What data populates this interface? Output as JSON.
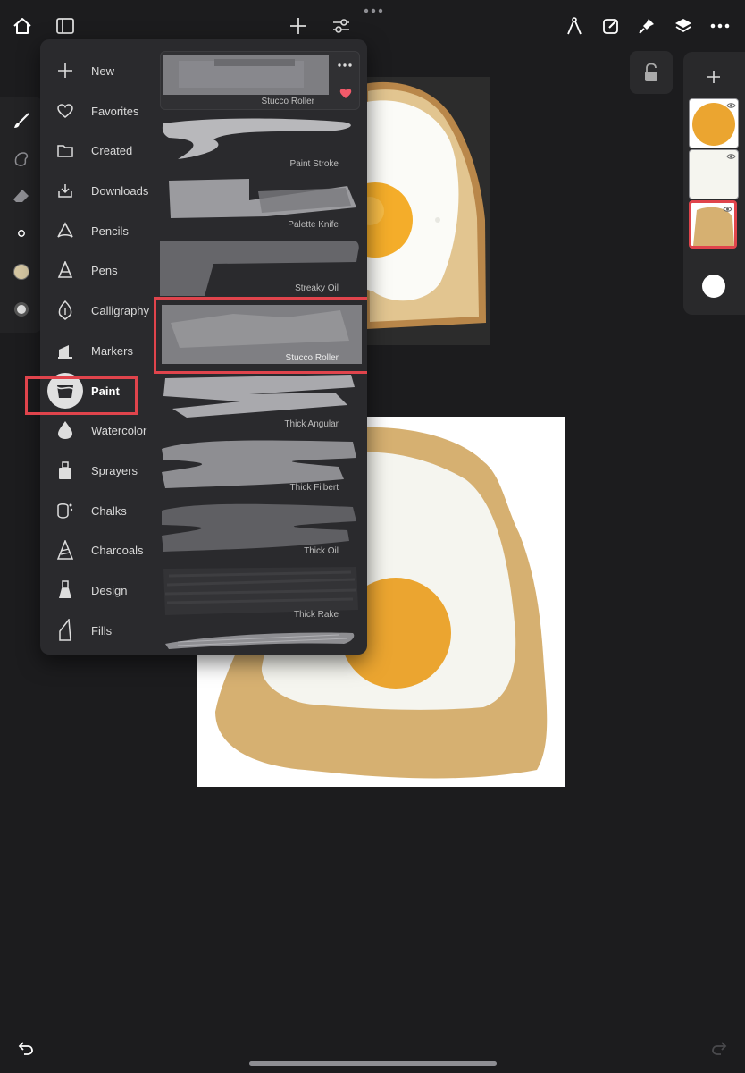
{
  "top_bar": {
    "left_icons": [
      "home-icon",
      "sidebar-toggle-icon"
    ],
    "center_icons": [
      "plus-icon",
      "sliders-icon"
    ],
    "right_icons": [
      "compass-icon",
      "edit-square-icon",
      "pin-icon",
      "layers-icon",
      "more-horizontal-icon"
    ]
  },
  "library": {
    "categories": [
      {
        "label": "New",
        "icon": "plus-icon"
      },
      {
        "label": "Favorites",
        "icon": "heart-icon"
      },
      {
        "label": "Created",
        "icon": "folder-icon"
      },
      {
        "label": "Downloads",
        "icon": "download-icon"
      },
      {
        "label": "Pencils",
        "icon": "pencil-icon"
      },
      {
        "label": "Pens",
        "icon": "pen-icon"
      },
      {
        "label": "Calligraphy",
        "icon": "calligraphy-nib-icon"
      },
      {
        "label": "Markers",
        "icon": "marker-icon"
      },
      {
        "label": "Paint",
        "icon": "paint-bucket-icon"
      },
      {
        "label": "Watercolor",
        "icon": "water-drop-icon"
      },
      {
        "label": "Sprayers",
        "icon": "spray-can-icon"
      },
      {
        "label": "Chalks",
        "icon": "chalk-icon"
      },
      {
        "label": "Charcoals",
        "icon": "charcoal-icon"
      },
      {
        "label": "Design",
        "icon": "design-icon"
      },
      {
        "label": "Fills",
        "icon": "fill-icon"
      }
    ],
    "selected_category": "Paint",
    "brushes": [
      {
        "label": "Stucco Roller",
        "favorite": true
      },
      {
        "label": "Paint Stroke"
      },
      {
        "label": "Palette Knife"
      },
      {
        "label": "Streaky Oil"
      },
      {
        "label": "Stucco Roller"
      },
      {
        "label": "Thick Angular"
      },
      {
        "label": "Thick Filbert"
      },
      {
        "label": "Thick Oil"
      },
      {
        "label": "Thick Rake"
      }
    ],
    "selected_brush": "Stucco Roller"
  },
  "tools": [
    "brush-icon",
    "smudge-icon",
    "eraser-icon",
    "brush-size-icon",
    "color-swatch-icon",
    "opacity-icon"
  ],
  "colors": {
    "accent_red": "#e0444c",
    "egg_yolk": "#eba530",
    "egg_white": "#f5f5ef",
    "toast": "#d6b071",
    "current_color": "#d4c6a2",
    "favorite_heart": "#f15a6a"
  },
  "layers": {
    "thumbnails": [
      "yolk-layer",
      "egg-white-layer",
      "toast-layer"
    ]
  }
}
